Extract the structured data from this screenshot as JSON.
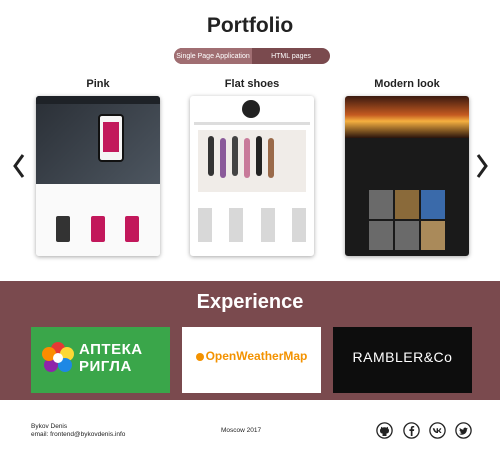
{
  "page": {
    "title": "Portfolio"
  },
  "tabs": [
    {
      "label": "Single Page Application",
      "active": true
    },
    {
      "label": "HTML pages",
      "active": false
    }
  ],
  "portfolio": {
    "items": [
      {
        "title": "Pink"
      },
      {
        "title": "Flat shoes"
      },
      {
        "title": "Modern look"
      }
    ]
  },
  "experience": {
    "title": "Experience",
    "logos": [
      {
        "text_line1": "АПТЕКА",
        "text_line2": "РИГЛА"
      },
      {
        "text": "OpenWeatherMap"
      },
      {
        "text": "RAMBLER&Co"
      }
    ]
  },
  "footer": {
    "name": "Bykov Denis",
    "email": "email: frontend@bykovdenis.info",
    "location": "Moscow 2017"
  },
  "colors": {
    "accent": "#7a4a4e",
    "tab_active": "#a06e72",
    "rigla_green": "#3aa64a",
    "owm_orange": "#f39200"
  },
  "icons": {
    "prev": "chevron-left-icon",
    "next": "chevron-right-icon",
    "social": [
      "github-icon",
      "facebook-icon",
      "vk-icon",
      "twitter-icon"
    ]
  }
}
